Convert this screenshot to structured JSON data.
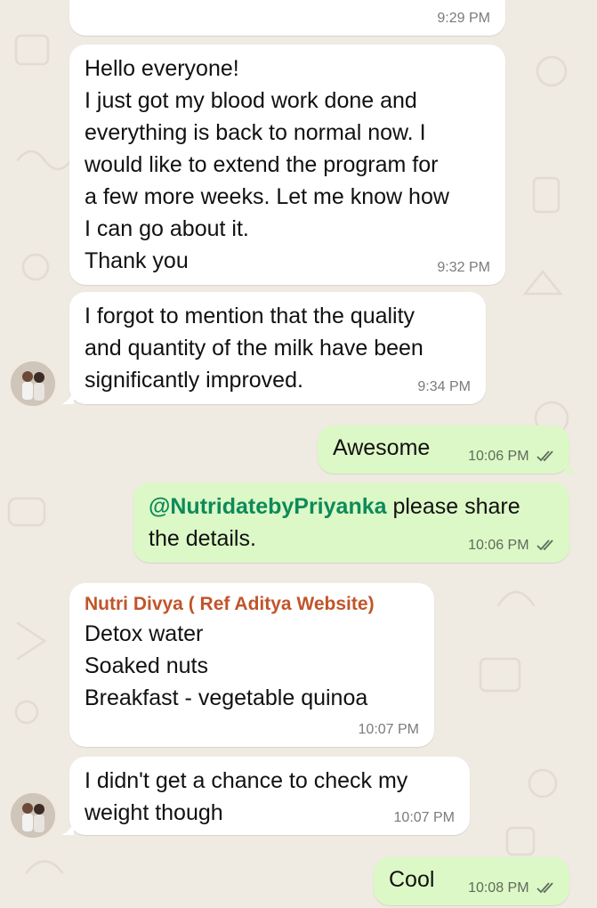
{
  "theme": {
    "wallpaper_color": "#efeae2",
    "incoming_bubble_color": "#ffffff",
    "outgoing_bubble_color": "#dcf8c6",
    "mention_color": "#0d8a5a",
    "sender_name_color": "#c0552a",
    "read_ticks_color": "#5f6b5c"
  },
  "messages": [
    {
      "direction": "incoming",
      "text": "",
      "time": "9:29 PM"
    },
    {
      "direction": "incoming",
      "text": "Hello everyone!\nI just got my blood work done and\neverything is back to normal now. I\nwould like to extend the program for\na few more weeks. Let me know how\nI can go about it.\nThank you",
      "time": "9:32 PM"
    },
    {
      "direction": "incoming",
      "text": "I forgot to mention that the quality\nand quantity of the milk have been\nsignificantly improved.",
      "time": "9:34 PM",
      "avatar": "avatar-photo"
    },
    {
      "direction": "outgoing",
      "text": "Awesome",
      "time": "10:06 PM",
      "status_icon": "read-ticks-icon"
    },
    {
      "direction": "outgoing",
      "mention": "@NutridatebyPriyanka",
      "text": " please share\nthe details.",
      "time": "10:06 PM",
      "status_icon": "read-ticks-icon"
    },
    {
      "direction": "incoming",
      "sender": "Nutri Divya ( Ref Aditya Website)",
      "text": "Detox water\nSoaked nuts\nBreakfast - vegetable quinoa",
      "time": "10:07 PM"
    },
    {
      "direction": "incoming",
      "text": "I didn't get a chance to check my\nweight though",
      "time": "10:07 PM",
      "avatar": "avatar-photo"
    },
    {
      "direction": "outgoing",
      "text": "Cool",
      "time": "10:08 PM",
      "status_icon": "read-ticks-icon"
    }
  ]
}
